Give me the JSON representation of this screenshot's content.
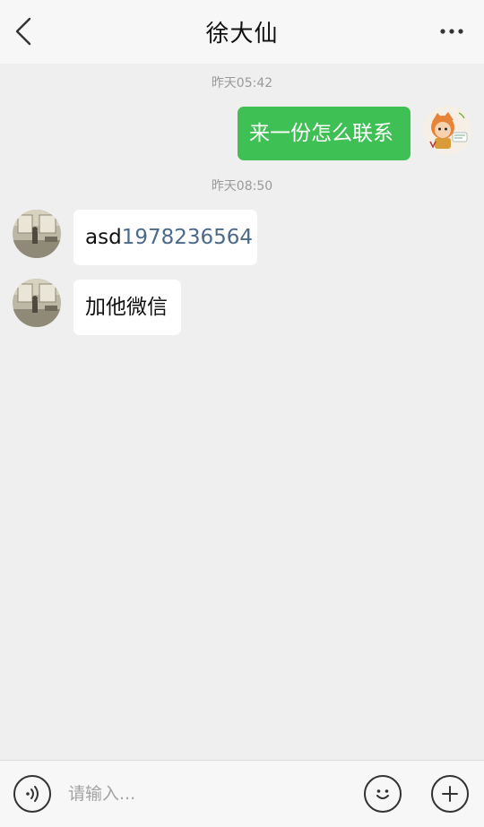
{
  "header": {
    "title": "徐大仙",
    "back_icon": "chevron-left-icon",
    "more_icon": "more-dots-icon"
  },
  "messages": [
    {
      "type": "time",
      "text": "昨天05:42"
    },
    {
      "type": "out",
      "text": "来一份怎么联系"
    },
    {
      "type": "time",
      "text": "昨天08:50"
    },
    {
      "type": "in",
      "prefix": "asd",
      "number": "1978236564"
    },
    {
      "type": "in",
      "text": "加他微信"
    }
  ],
  "input_bar": {
    "voice_icon": "voice-icon",
    "placeholder": "请输入...",
    "emoji_icon": "emoji-icon",
    "add_icon": "plus-icon"
  },
  "colors": {
    "outgoing_bubble": "#3fc054",
    "incoming_bubble": "#ffffff",
    "background": "#efefef",
    "link_number": "#4b6a8a"
  }
}
